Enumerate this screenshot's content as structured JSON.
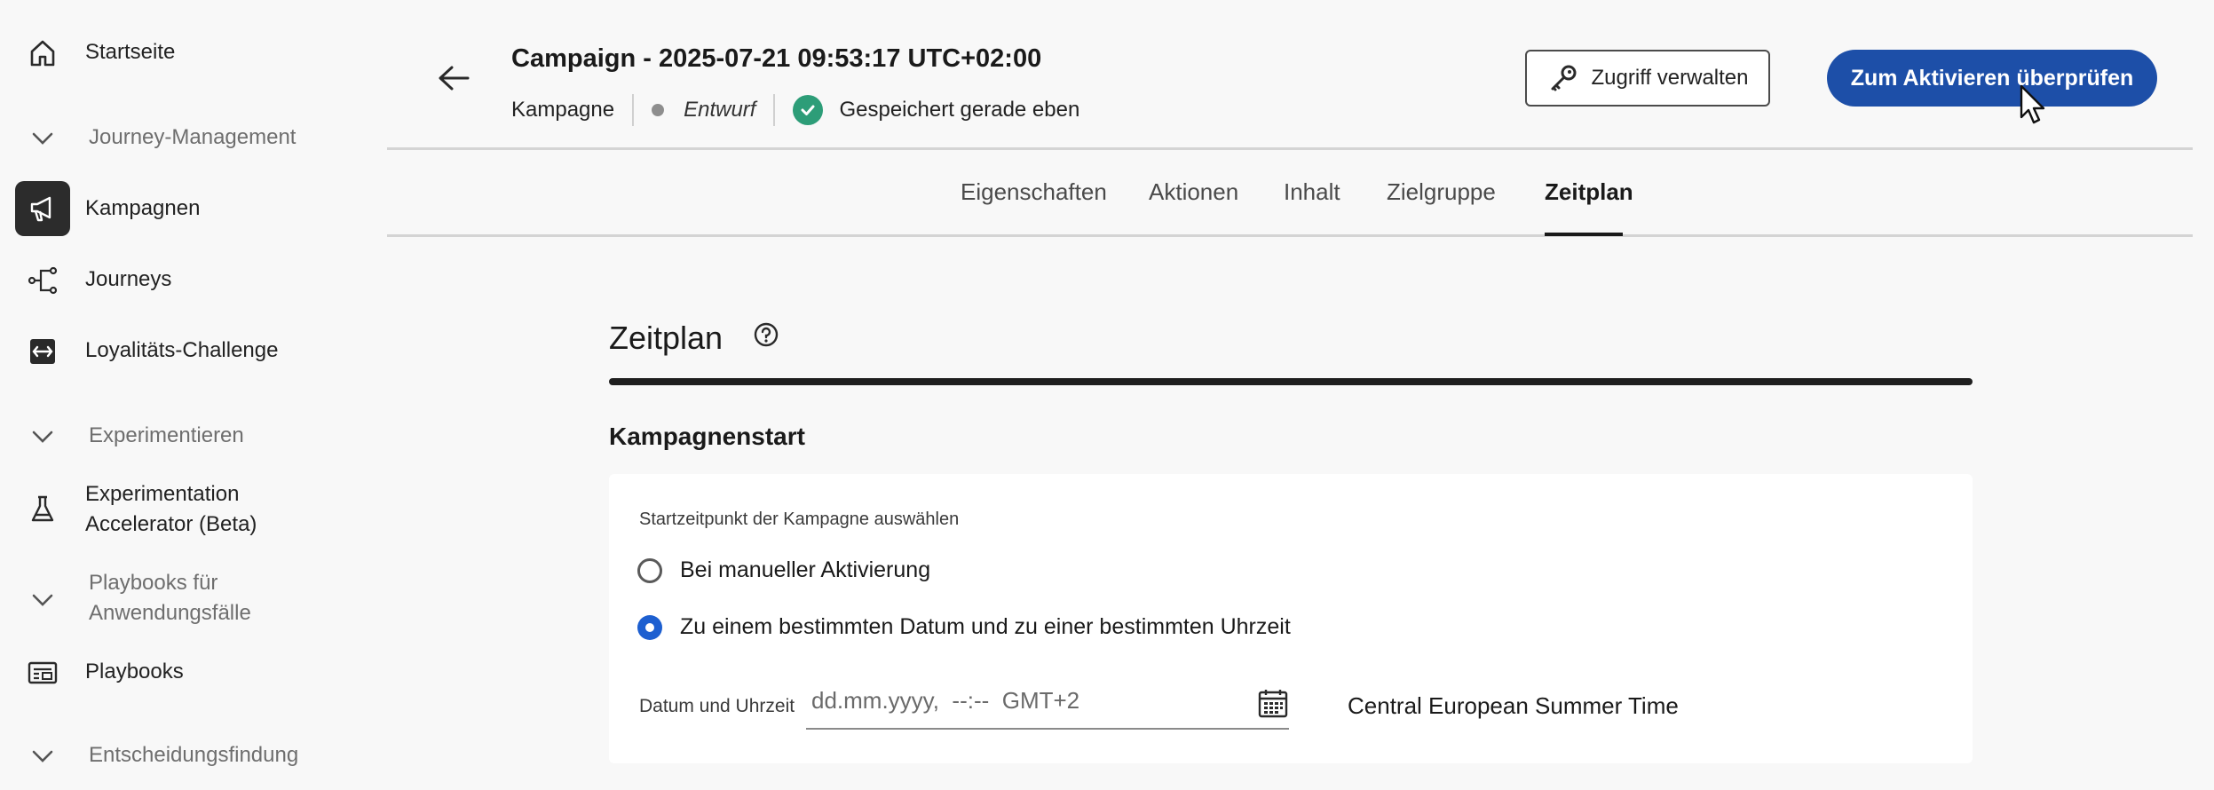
{
  "sidebar": {
    "home": "Startseite",
    "section_journey": "Journey-Management",
    "campaigns": "Kampagnen",
    "journeys": "Journeys",
    "loyalty": "Loyalitäts-Challenge",
    "section_experiment": "Experimentieren",
    "exp_accel_line1": "Experimentation",
    "exp_accel_line2": "Accelerator (Beta)",
    "section_playbooks_line1": "Playbooks für",
    "section_playbooks_line2": "Anwendungsfälle",
    "playbooks": "Playbooks",
    "section_decisioning": "Entscheidungsfindung"
  },
  "header": {
    "title": "Campaign - 2025-07-21 09:53:17 UTC+02:00",
    "type": "Kampagne",
    "status": "Entwurf",
    "saved": "Gespeichert gerade eben",
    "access_button": "Zugriff verwalten",
    "review_button": "Zum Aktivieren überprüfen"
  },
  "tabs": {
    "properties": "Eigenschaften",
    "actions": "Aktionen",
    "content": "Inhalt",
    "audience": "Zielgruppe",
    "schedule": "Zeitplan"
  },
  "schedule": {
    "title": "Zeitplan",
    "subtitle": "Kampagnenstart",
    "card_label": "Startzeitpunkt der Kampagne auswählen",
    "option_manual": "Bei manueller Aktivierung",
    "option_datetime": "Zu einem bestimmten Datum und zu einer bestimmten Uhrzeit",
    "datetime_label": "Datum und Uhrzeit",
    "datetime_placeholder": "dd.mm.yyyy,  --:--  GMT+2",
    "timezone": "Central European Summer Time"
  },
  "colors": {
    "primary": "#1d4fa8",
    "radio_selected": "#1d5fd0",
    "success": "#2d9d78"
  }
}
